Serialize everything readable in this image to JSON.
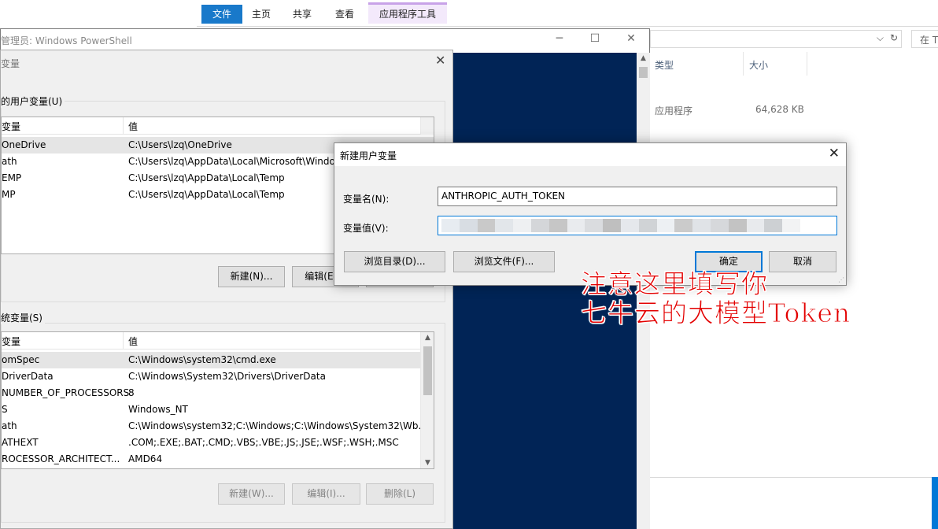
{
  "explorer": {
    "tabs": [
      {
        "label": "文件",
        "active": true
      },
      {
        "label": "主页"
      },
      {
        "label": "共享"
      },
      {
        "label": "查看"
      },
      {
        "label": "应用程序工具",
        "contextual": true
      }
    ],
    "search_placeholder": "在 T",
    "columns": {
      "type": "类型",
      "size": "大小"
    },
    "file": {
      "type": "应用程序",
      "size": "64,628 KB"
    }
  },
  "powershell": {
    "title": "管理员: Windows PowerShell",
    "controls": {
      "minimize": "─",
      "maximize": "☐",
      "close": "✕"
    }
  },
  "env_dialog": {
    "title": "变量",
    "close": "✕",
    "user_group_label": "的用户变量(U)",
    "system_group_label": "统变量(S)",
    "col_var": "变量",
    "col_value": "值",
    "user_vars": [
      {
        "name": "OneDrive",
        "value": "C:\\Users\\lzq\\OneDrive"
      },
      {
        "name": "ath",
        "value": "C:\\Users\\lzq\\AppData\\Local\\Microsoft\\WindowsApps;"
      },
      {
        "name": "EMP",
        "value": "C:\\Users\\lzq\\AppData\\Local\\Temp"
      },
      {
        "name": "MP",
        "value": "C:\\Users\\lzq\\AppData\\Local\\Temp"
      }
    ],
    "user_buttons": {
      "new": "新建(N)...",
      "edit": "编辑(E)..."
    },
    "system_vars": [
      {
        "name": "omSpec",
        "value": "C:\\Windows\\system32\\cmd.exe"
      },
      {
        "name": "DriverData",
        "value": "C:\\Windows\\System32\\Drivers\\DriverData"
      },
      {
        "name": "NUMBER_OF_PROCESSORS",
        "value": "8"
      },
      {
        "name": "S",
        "value": "Windows_NT"
      },
      {
        "name": "ath",
        "value": "C:\\Windows\\system32;C:\\Windows;C:\\Windows\\System32\\Wb..."
      },
      {
        "name": "ATHEXT",
        "value": ".COM;.EXE;.BAT;.CMD;.VBS;.VBE;.JS;.JSE;.WSF;.WSH;.MSC"
      },
      {
        "name": "ROCESSOR_ARCHITECT...",
        "value": "AMD64"
      }
    ],
    "system_buttons": {
      "new": "新建(W)...",
      "edit": "编辑(I)...",
      "delete": "删除(L)"
    }
  },
  "new_var_dialog": {
    "title": "新建用户变量",
    "close": "✕",
    "name_label": "变量名(N):",
    "name_value": "ANTHROPIC_AUTH_TOKEN",
    "value_label": "变量值(V):",
    "browse_dir": "浏览目录(D)...",
    "browse_file": "浏览文件(F)...",
    "ok": "确定",
    "cancel": "取消"
  },
  "annotation": {
    "line1": "注意这里填写你",
    "line2": "七牛云的大模型Token",
    "color": "#e30000"
  }
}
